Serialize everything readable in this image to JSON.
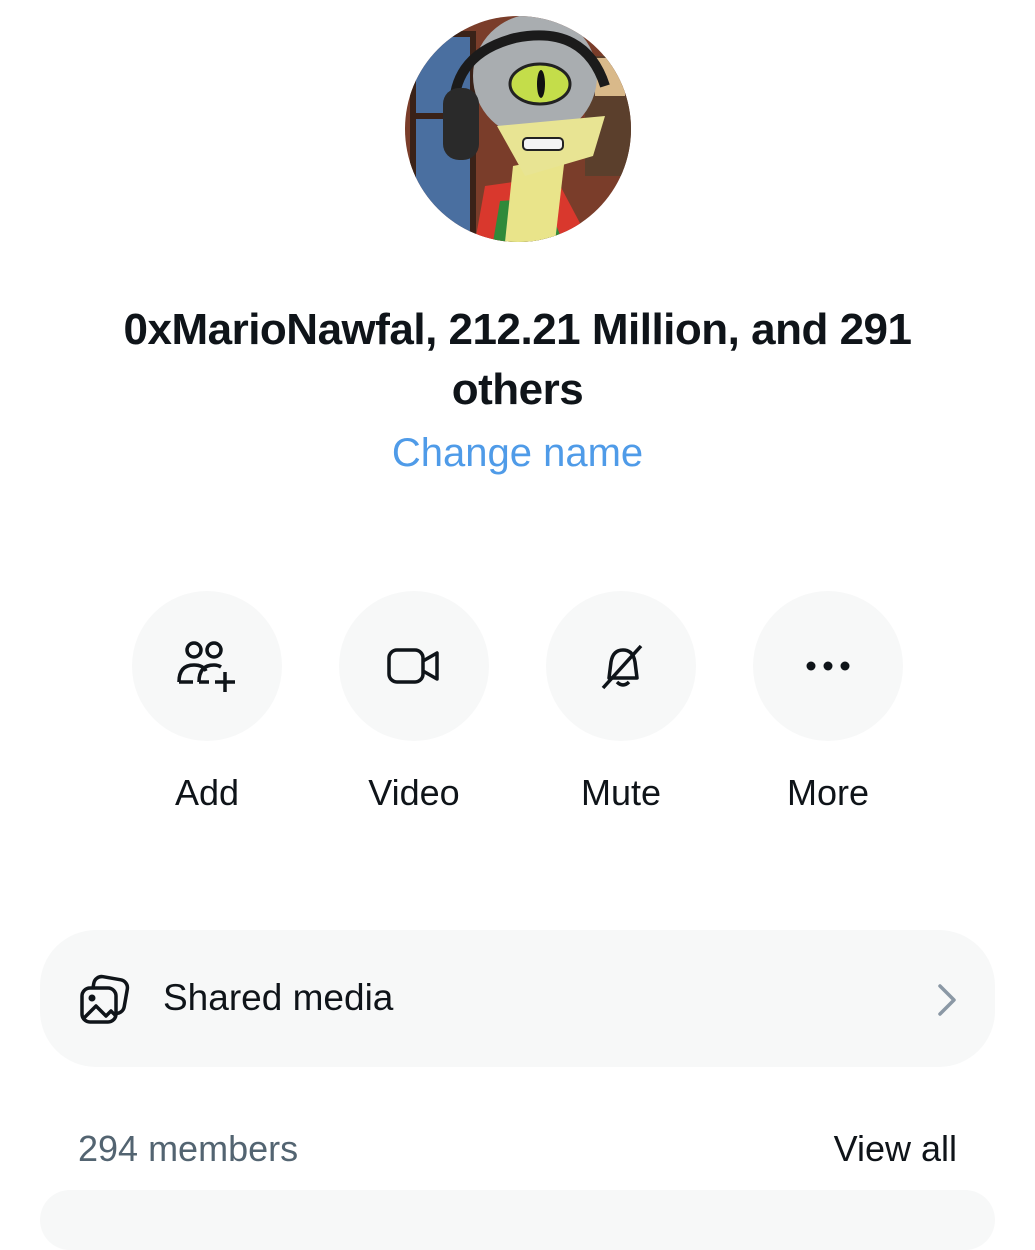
{
  "conversation": {
    "avatar_icon": "lizard-with-headphones-avatar",
    "title": "0xMarioNawfal, 212.21 Million, and 291 others",
    "change_name_label": "Change name"
  },
  "actions": [
    {
      "label": "Add",
      "icon": "add-people-icon"
    },
    {
      "label": "Video",
      "icon": "video-camera-icon"
    },
    {
      "label": "Mute",
      "icon": "bell-off-icon"
    },
    {
      "label": "More",
      "icon": "more-dots-icon"
    }
  ],
  "shared_media": {
    "label": "Shared media",
    "icon": "gallery-icon"
  },
  "members": {
    "count_label": "294 members",
    "view_all_label": "View all"
  },
  "colors": {
    "accent_link": "#4f9be8",
    "button_background": "#f7f8f8",
    "secondary_text": "#536471",
    "primary_text": "#0f1419"
  }
}
